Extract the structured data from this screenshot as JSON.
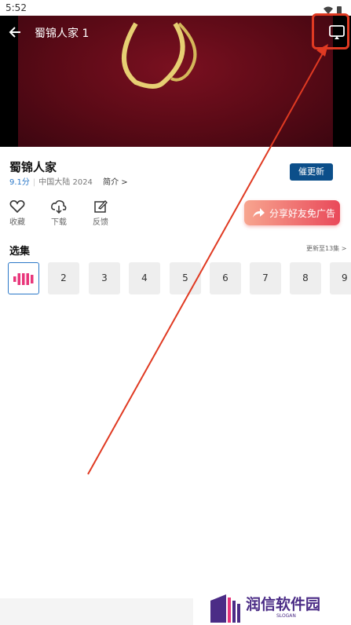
{
  "status_bar": {
    "time": "5:52"
  },
  "player": {
    "title": "蜀锦人家 1"
  },
  "show": {
    "title": "蜀锦人家",
    "score": "9.1分",
    "region": "中国大陆",
    "year": "2024",
    "intro_label": "简介 >",
    "urge_update_label": "催更新"
  },
  "actions": {
    "favorite": "收藏",
    "download": "下载",
    "feedback": "反馈",
    "share_label": "分享好友免广告"
  },
  "episodes": {
    "title": "选集",
    "update_info": "更新至13集 >",
    "items": [
      "2",
      "3",
      "4",
      "5",
      "6",
      "7",
      "8",
      "9"
    ]
  },
  "watermark": {
    "text": "润信软件园",
    "slogan": "SLOGAN"
  },
  "colors": {
    "accent_blue": "#0c4f8a",
    "score_blue": "#2b78c8",
    "annotation_red": "#e03a22",
    "brand_purple": "#4b2c86"
  }
}
